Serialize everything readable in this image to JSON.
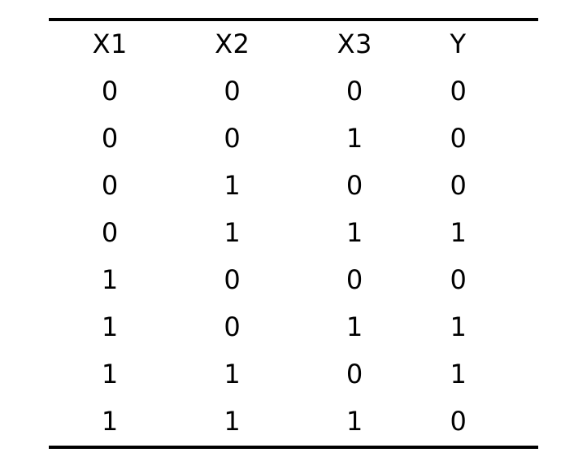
{
  "chart_data": {
    "type": "table",
    "title": "",
    "columns": [
      "X1",
      "X2",
      "X3",
      "Y"
    ],
    "rows": [
      [
        0,
        0,
        0,
        0
      ],
      [
        0,
        0,
        1,
        0
      ],
      [
        0,
        1,
        0,
        0
      ],
      [
        0,
        1,
        1,
        1
      ],
      [
        1,
        0,
        0,
        0
      ],
      [
        1,
        0,
        1,
        1
      ],
      [
        1,
        1,
        0,
        1
      ],
      [
        1,
        1,
        1,
        0
      ]
    ]
  }
}
